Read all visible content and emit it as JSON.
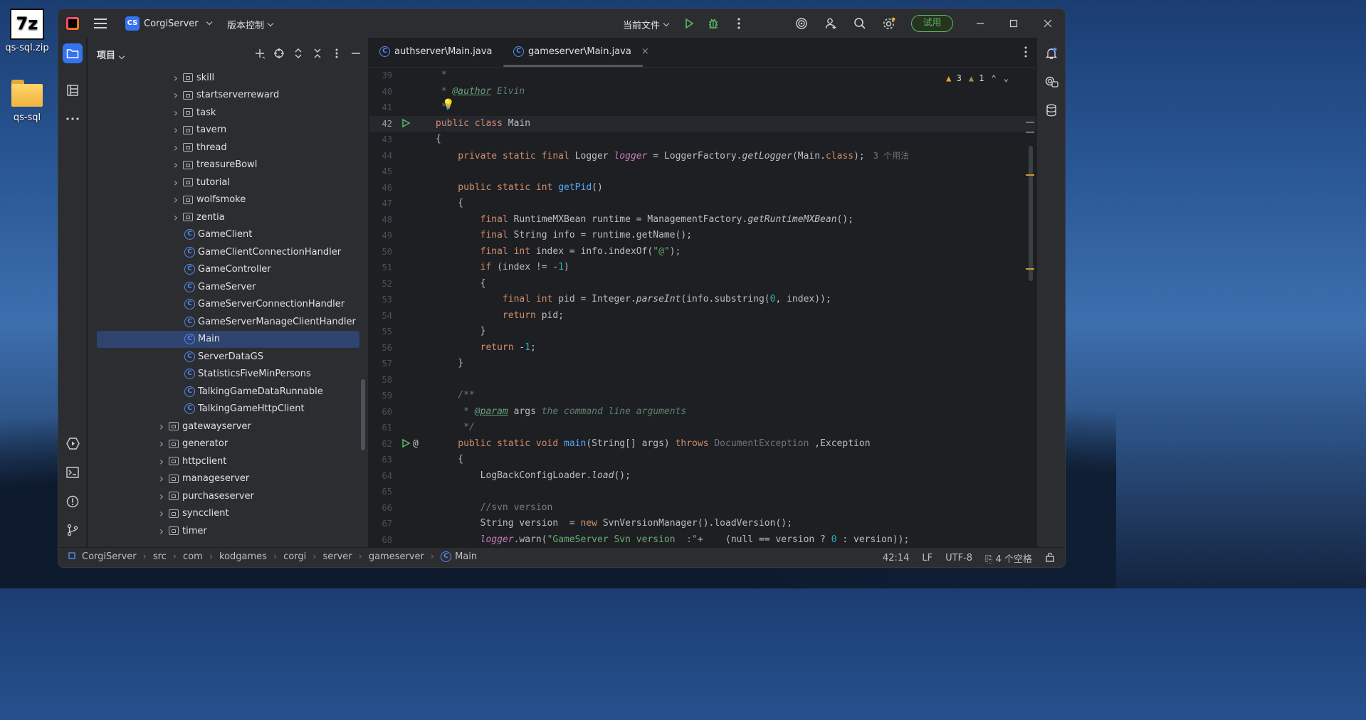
{
  "desktop": {
    "icons": [
      {
        "label": "qs-sql.zip",
        "glyph": "7z"
      },
      {
        "label": "qs-sql"
      }
    ]
  },
  "titlebar": {
    "project_badge": "CS",
    "project_name": "CorgiServer",
    "vcs_label": "版本控制",
    "run_config": "当前文件",
    "trial_label": "试用"
  },
  "project_panel": {
    "title": "项目",
    "tree": [
      {
        "label": "skill",
        "kind": "folder",
        "depth": 2
      },
      {
        "label": "startserverreward",
        "kind": "folder",
        "depth": 2
      },
      {
        "label": "task",
        "kind": "folder",
        "depth": 2
      },
      {
        "label": "tavern",
        "kind": "folder",
        "depth": 2
      },
      {
        "label": "thread",
        "kind": "folder",
        "depth": 2
      },
      {
        "label": "treasureBowl",
        "kind": "folder",
        "depth": 2
      },
      {
        "label": "tutorial",
        "kind": "folder",
        "depth": 2
      },
      {
        "label": "wolfsmoke",
        "kind": "folder",
        "depth": 2
      },
      {
        "label": "zentia",
        "kind": "folder",
        "depth": 2
      },
      {
        "label": "GameClient",
        "kind": "class",
        "depth": 2
      },
      {
        "label": "GameClientConnectionHandler",
        "kind": "class",
        "depth": 2
      },
      {
        "label": "GameController",
        "kind": "class",
        "depth": 2
      },
      {
        "label": "GameServer",
        "kind": "class",
        "depth": 2
      },
      {
        "label": "GameServerConnectionHandler",
        "kind": "class",
        "depth": 2
      },
      {
        "label": "GameServerManageClientHandler",
        "kind": "class",
        "depth": 2
      },
      {
        "label": "Main",
        "kind": "class",
        "depth": 2,
        "selected": true
      },
      {
        "label": "ServerDataGS",
        "kind": "class",
        "depth": 2
      },
      {
        "label": "StatisticsFiveMinPersons",
        "kind": "class",
        "depth": 2
      },
      {
        "label": "TalkingGameDataRunnable",
        "kind": "class",
        "depth": 2
      },
      {
        "label": "TalkingGameHttpClient",
        "kind": "class",
        "depth": 2
      },
      {
        "label": "gatewayserver",
        "kind": "folder",
        "depth": 1
      },
      {
        "label": "generator",
        "kind": "folder",
        "depth": 1
      },
      {
        "label": "httpclient",
        "kind": "folder",
        "depth": 1
      },
      {
        "label": "manageserver",
        "kind": "folder",
        "depth": 1
      },
      {
        "label": "purchaseserver",
        "kind": "folder",
        "depth": 1
      },
      {
        "label": "syncclient",
        "kind": "folder",
        "depth": 1
      },
      {
        "label": "timer",
        "kind": "folder",
        "depth": 1
      }
    ]
  },
  "editor": {
    "tabs": [
      {
        "label": "authserver\\Main.java",
        "active": false
      },
      {
        "label": "gameserver\\Main.java",
        "active": true
      }
    ],
    "warning_count": "3",
    "weak_warning_count": "1",
    "current_line": 42,
    "lines": [
      {
        "n": 39,
        "tokens": [
          [
            "dc",
            " *"
          ]
        ]
      },
      {
        "n": 40,
        "tokens": [
          [
            "dc",
            " * "
          ],
          [
            "tag",
            "@author"
          ],
          [
            "dc",
            " Elvin"
          ]
        ]
      },
      {
        "n": 41,
        "tokens": [
          [
            "dc",
            " */"
          ]
        ]
      },
      {
        "n": 42,
        "tokens": [
          [
            "kw",
            "public class "
          ],
          [
            "",
            "Main"
          ]
        ],
        "run": true
      },
      {
        "n": 43,
        "tokens": [
          [
            "",
            "{"
          ]
        ]
      },
      {
        "n": 44,
        "tokens": [
          [
            "kw",
            "    private static final "
          ],
          [
            "",
            "Logger "
          ],
          [
            "fld",
            "logger"
          ],
          [
            "",
            " = LoggerFactory."
          ],
          [
            "it",
            "getLogger"
          ],
          [
            "",
            "(Main."
          ],
          [
            "kw",
            "class"
          ],
          [
            "",
            ");"
          ]
        ],
        "hint": "3 个用法"
      },
      {
        "n": 45,
        "tokens": [
          [
            "",
            ""
          ]
        ]
      },
      {
        "n": 46,
        "tokens": [
          [
            "kw",
            "    public static int "
          ],
          [
            "fn",
            "getPid"
          ],
          [
            "",
            "()"
          ]
        ]
      },
      {
        "n": 47,
        "tokens": [
          [
            "",
            "    {"
          ]
        ]
      },
      {
        "n": 48,
        "tokens": [
          [
            "kw",
            "        final "
          ],
          [
            "",
            "RuntimeMXBean runtime = ManagementFactory."
          ],
          [
            "it",
            "getRuntimeMXBean"
          ],
          [
            "",
            "();"
          ]
        ]
      },
      {
        "n": 49,
        "tokens": [
          [
            "kw",
            "        final "
          ],
          [
            "",
            "String info = runtime.getName();"
          ]
        ]
      },
      {
        "n": 50,
        "tokens": [
          [
            "kw",
            "        final int "
          ],
          [
            "",
            "index = info.indexOf("
          ],
          [
            "st",
            "\"@\""
          ],
          [
            "",
            ");"
          ]
        ]
      },
      {
        "n": 51,
        "tokens": [
          [
            "kw",
            "        if "
          ],
          [
            "",
            "(index != -"
          ],
          [
            "nm",
            "1"
          ],
          [
            "",
            ")"
          ]
        ]
      },
      {
        "n": 52,
        "tokens": [
          [
            "",
            "        {"
          ]
        ]
      },
      {
        "n": 53,
        "tokens": [
          [
            "kw",
            "            final int "
          ],
          [
            "",
            "pid = Integer."
          ],
          [
            "it",
            "parseInt"
          ],
          [
            "",
            "(info.substring("
          ],
          [
            "nm",
            "0"
          ],
          [
            "",
            ", index));"
          ]
        ]
      },
      {
        "n": 54,
        "tokens": [
          [
            "kw",
            "            return "
          ],
          [
            "",
            "pid;"
          ]
        ]
      },
      {
        "n": 55,
        "tokens": [
          [
            "",
            "        }"
          ]
        ]
      },
      {
        "n": 56,
        "tokens": [
          [
            "kw",
            "        return "
          ],
          [
            "",
            "-"
          ],
          [
            "nm",
            "1"
          ],
          [
            "",
            ";"
          ]
        ]
      },
      {
        "n": 57,
        "tokens": [
          [
            "",
            "    }"
          ]
        ]
      },
      {
        "n": 58,
        "tokens": [
          [
            "",
            ""
          ]
        ]
      },
      {
        "n": 59,
        "tokens": [
          [
            "dc",
            "    /**"
          ]
        ]
      },
      {
        "n": 60,
        "tokens": [
          [
            "dc",
            "     * "
          ],
          [
            "tag",
            "@param"
          ],
          [
            "dc",
            " "
          ],
          [
            "",
            "args"
          ],
          [
            "dc",
            " the command line arguments"
          ]
        ]
      },
      {
        "n": 61,
        "tokens": [
          [
            "dc",
            "     */"
          ]
        ]
      },
      {
        "n": 62,
        "tokens": [
          [
            "kw",
            "    public static void "
          ],
          [
            "fn",
            "main"
          ],
          [
            "",
            "(String[] args) "
          ],
          [
            "kw",
            "throws "
          ],
          [
            "gray",
            "DocumentException"
          ],
          [
            "",
            " ,Exception"
          ]
        ],
        "run": true,
        "at": true
      },
      {
        "n": 63,
        "tokens": [
          [
            "",
            "    {"
          ]
        ]
      },
      {
        "n": 64,
        "tokens": [
          [
            "",
            "        LogBackConfigLoader."
          ],
          [
            "it",
            "load"
          ],
          [
            "",
            "();"
          ]
        ]
      },
      {
        "n": 65,
        "tokens": [
          [
            "",
            ""
          ]
        ]
      },
      {
        "n": 66,
        "tokens": [
          [
            "cm",
            "        //svn version"
          ]
        ]
      },
      {
        "n": 67,
        "tokens": [
          [
            "",
            "        String version  = "
          ],
          [
            "kw",
            "new "
          ],
          [
            "",
            "SvnVersionManager().loadVersion();"
          ]
        ]
      },
      {
        "n": 68,
        "tokens": [
          [
            "fld",
            "        logger"
          ],
          [
            "",
            ".warn("
          ],
          [
            "st",
            "\"GameServer Svn version  :\""
          ],
          [
            "",
            "+    (null == version ? "
          ],
          [
            "nm",
            "0"
          ],
          [
            "",
            " : version));"
          ]
        ]
      }
    ]
  },
  "statusbar": {
    "breadcrumbs": [
      "CorgiServer",
      "src",
      "com",
      "kodgames",
      "corgi",
      "server",
      "gameserver",
      "Main"
    ],
    "position": "42:14",
    "line_sep": "LF",
    "encoding": "UTF-8",
    "indent": "4 个空格"
  },
  "colors": {
    "accent": "#3574f0",
    "trial": "#5fb865",
    "warning": "#e5a82a"
  }
}
